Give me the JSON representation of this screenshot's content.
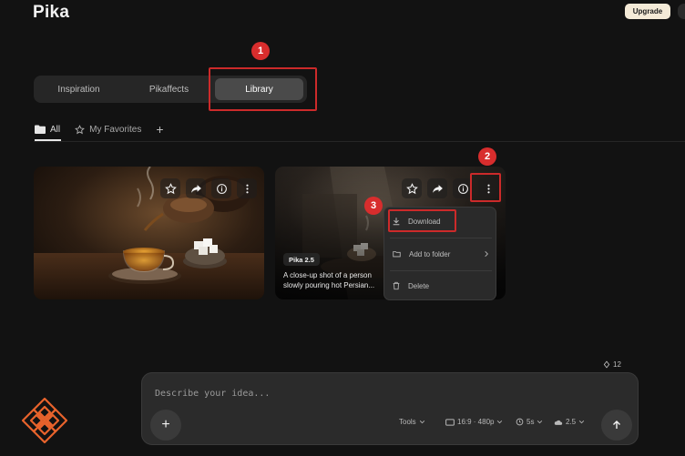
{
  "header": {
    "logo": "Pika",
    "upgrade_label": "Upgrade"
  },
  "tabs": [
    {
      "label": "Inspiration"
    },
    {
      "label": "Pikaffects"
    },
    {
      "label": "Library",
      "active": true
    }
  ],
  "filters": {
    "all_label": "All",
    "favorites_label": "My Favorites",
    "add_label": "+"
  },
  "annotations": [
    "1",
    "2",
    "3"
  ],
  "cards": [
    {
      "icons": [
        "star-icon",
        "share-icon",
        "info-icon",
        "more-icon"
      ]
    },
    {
      "model_badge": "Pika 2.5",
      "caption": "A close-up shot of a person slowly pouring hot Persian...",
      "icons": [
        "star-icon",
        "share-icon",
        "info-icon",
        "more-icon"
      ]
    }
  ],
  "menu": {
    "items": [
      {
        "label": "Download",
        "icon": "download-icon"
      },
      {
        "label": "Add to folder",
        "icon": "folder-icon"
      },
      {
        "label": "Delete",
        "icon": "trash-icon"
      }
    ]
  },
  "credits": "12",
  "prompt": {
    "placeholder": "Describe your idea...",
    "plus_label": "+",
    "tools_label": "Tools",
    "aspect_label": "16:9 · 480p",
    "duration_label": "5s",
    "model_label": "2.5"
  },
  "colors": {
    "background": "#121212",
    "annotation_red": "#d82d2d",
    "brand_orange": "#e8632c",
    "upgrade_bg": "#f4ead7"
  }
}
